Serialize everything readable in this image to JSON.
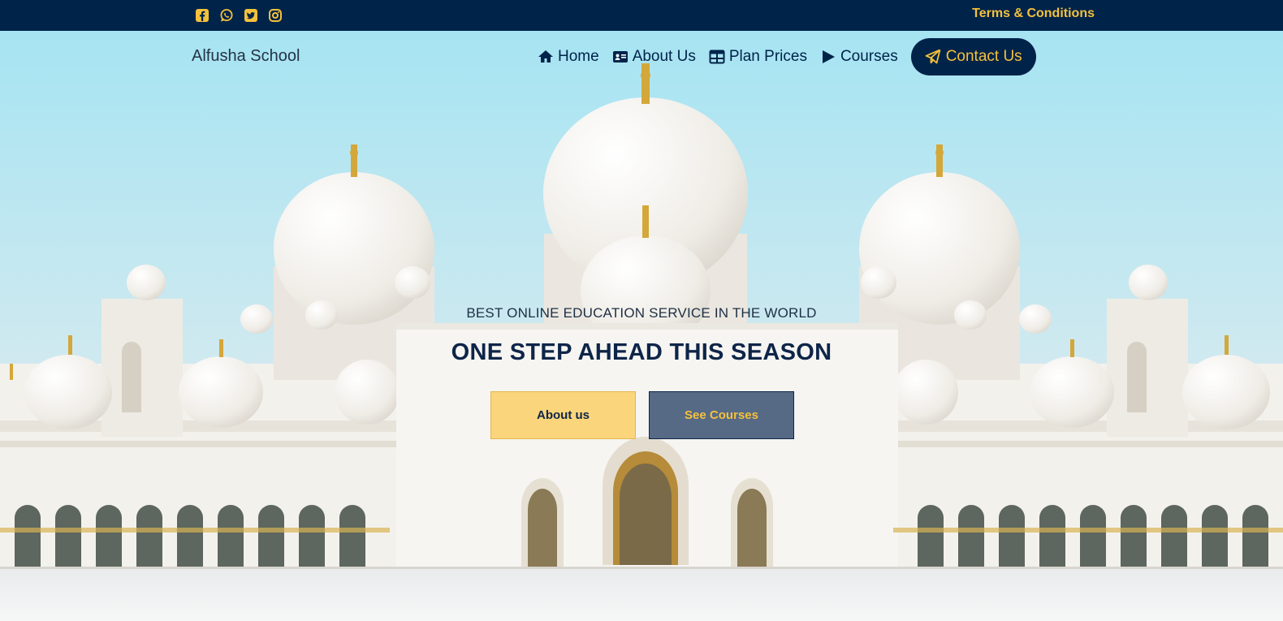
{
  "topbar": {
    "socials": [
      {
        "icon": "facebook-icon"
      },
      {
        "icon": "whatsapp-icon"
      },
      {
        "icon": "twitter-icon"
      },
      {
        "icon": "instagram-icon"
      }
    ],
    "terms_label": "Terms & Conditions"
  },
  "brand": "Alfusha School",
  "nav": {
    "home": "Home",
    "about": "About Us",
    "plans": "Plan Prices",
    "courses": "Courses",
    "contact": "Contact Us"
  },
  "hero": {
    "subtitle": "BEST ONLINE EDUCATION SERVICE IN THE WORLD",
    "title": "ONE STEP AHEAD THIS SEASON",
    "about_button": "About us",
    "courses_button": "See Courses"
  },
  "colors": {
    "navy": "#00234a",
    "gold": "#f4c13b",
    "about_button_bg": "#fad57c",
    "courses_button_bg": "#566a86"
  }
}
